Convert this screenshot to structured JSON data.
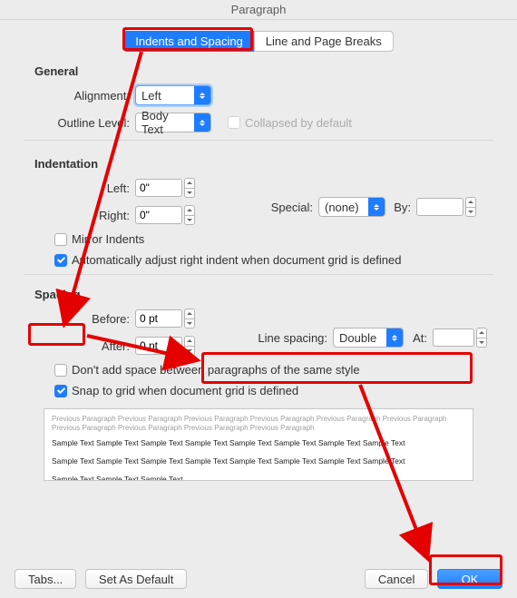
{
  "window": {
    "title": "Paragraph"
  },
  "tabs": {
    "indents_spacing": "Indents and Spacing",
    "line_breaks": "Line and Page Breaks"
  },
  "general": {
    "title": "General",
    "alignment_label": "Alignment:",
    "alignment_value": "Left",
    "outline_label": "Outline Level:",
    "outline_value": "Body Text",
    "collapsed_label": "Collapsed by default"
  },
  "indentation": {
    "title": "Indentation",
    "left_label": "Left:",
    "left_value": "0\"",
    "right_label": "Right:",
    "right_value": "0\"",
    "special_label": "Special:",
    "special_value": "(none)",
    "by_label": "By:",
    "by_value": "",
    "mirror_label": "Mirror Indents",
    "auto_label": "Automatically adjust right indent when document grid is defined"
  },
  "spacing": {
    "title": "Spacing",
    "before_label": "Before:",
    "before_value": "0 pt",
    "after_label": "After:",
    "after_value": "0 pt",
    "line_spacing_label": "Line spacing:",
    "line_spacing_value": "Double",
    "at_label": "At:",
    "at_value": "",
    "dont_add_label": "Don't add space between paragraphs of the same style",
    "snap_label": "Snap to grid when document grid is defined"
  },
  "preview": {
    "prev_text": "Previous Paragraph Previous Paragraph Previous Paragraph Previous Paragraph Previous Paragraph Previous Paragraph Previous Paragraph Previous Paragraph Previous Paragraph Previous Paragraph",
    "sample_text": "Sample Text Sample Text Sample Text Sample Text Sample Text Sample Text Sample Text Sample Text",
    "sample_text2": "Sample Text Sample Text Sample Text Sample Text Sample Text Sample Text Sample Text Sample Text",
    "sample_text3": "Sample Text Sample Text Sample Text"
  },
  "buttons": {
    "tabs": "Tabs...",
    "default": "Set As Default",
    "cancel": "Cancel",
    "ok": "OK"
  }
}
